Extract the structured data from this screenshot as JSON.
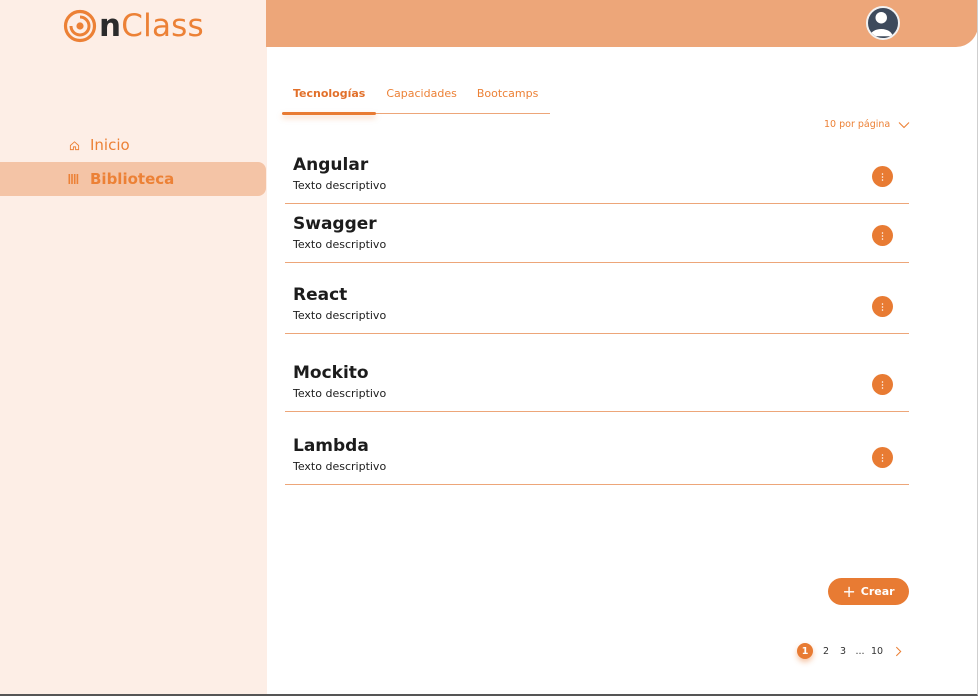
{
  "app": {
    "logo_letter": "n",
    "logo_rest": "Class"
  },
  "sidebar": {
    "items": [
      {
        "label": "Inicio",
        "icon": "home-icon"
      },
      {
        "label": "Biblioteca",
        "icon": "library-icon",
        "active": true
      }
    ]
  },
  "header": {
    "avatar": "user-avatar"
  },
  "tabs": [
    {
      "label": "Tecnologías",
      "active": true
    },
    {
      "label": "Capacidades"
    },
    {
      "label": "Bootcamps"
    }
  ],
  "per_page": {
    "label": "10 por página"
  },
  "items": [
    {
      "title": "Angular",
      "description": "Texto descriptivo"
    },
    {
      "title": "Swagger",
      "description": "Texto descriptivo"
    },
    {
      "title": "React",
      "description": "Texto descriptivo"
    },
    {
      "title": "Mockito",
      "description": "Texto descriptivo"
    },
    {
      "title": "Lambda",
      "description": "Texto descriptivo"
    }
  ],
  "create_button": {
    "label": "Crear"
  },
  "pagination": {
    "pages": [
      "1",
      "2",
      "3",
      "...",
      "10"
    ],
    "current": "1"
  },
  "colors": {
    "accent": "#e87b33",
    "header": "#eda679",
    "sidebar": "#fdeee6",
    "active_nav": "#f4c4a6"
  }
}
